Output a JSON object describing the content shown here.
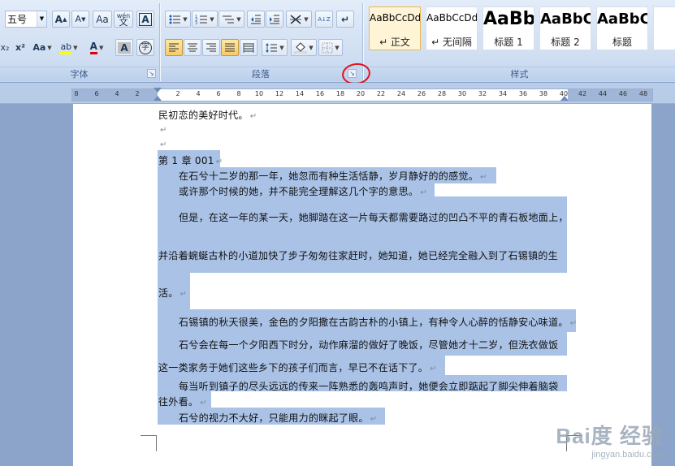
{
  "ribbon": {
    "font_group": {
      "label": "字体",
      "font_size": "五号",
      "grow_font": "A",
      "shrink_font": "A",
      "subscript": "x₂",
      "superscript": "x²",
      "change_case": "Aa",
      "phonetic": "wén",
      "char_border": "A",
      "highlight": "ab",
      "font_color": "A",
      "char_shading": "A",
      "enclose_char": "字"
    },
    "paragraph_group": {
      "label": "段落",
      "sort": "A↓Z",
      "show_marks": "↵"
    },
    "styles_group": {
      "label": "样式",
      "tiles": [
        {
          "sample": "AaBbCcDd",
          "name": "↵ 正文"
        },
        {
          "sample": "AaBbCcDd",
          "name": "↵ 无间隔"
        },
        {
          "sample": "AaBb",
          "name": "标题 1"
        },
        {
          "sample": "AaBbC",
          "name": "标题 2"
        },
        {
          "sample": "AaBbC",
          "name": "标题"
        }
      ]
    }
  },
  "ruler": {
    "left_ticks": [
      "8",
      "6",
      "4",
      "2"
    ],
    "ticks": [
      "2",
      "4",
      "6",
      "8",
      "10",
      "12",
      "14",
      "16",
      "18",
      "20",
      "22",
      "24",
      "26",
      "28",
      "30",
      "32",
      "34",
      "36",
      "38",
      "40"
    ],
    "right_ticks": [
      "42",
      "44",
      "46",
      "48"
    ]
  },
  "document": {
    "lines": [
      "民初恋的美好时代。",
      "",
      "",
      "第 1 章 001",
      "在石兮十二岁的那一年，她忽而有种生活恬静，岁月静好的的感觉。",
      "或许那个时候的她，并不能完全理解这几个字的意思。",
      "但是，在这一年的某一天，她脚踏在这一片每天都需要路过的凹凸不平的青石板地面上，",
      "并沿着蜿蜒古朴的小道加快了步子匆匆往家赶时，她知道，她已经完全融入到了石锡镇的生",
      "活。",
      "石锡镇的秋天很美，金色的夕阳撒在古韵古朴的小镇上，有种令人心醉的恬静安心味道。",
      "石兮会在每一个夕阳西下时分，动作麻溜的做好了晚饭，尽管她才十二岁，但洗衣做饭",
      "这一类家务于她们这些乡下的孩子们而言，早已不在话下了。",
      "每当听到镇子的尽头远远的传来一阵熟悉的轰鸣声时，她便会立即踮起了脚尖伸着脑袋",
      "往外看。",
      "石兮的视力不大好，只能用力的眯起了眼。"
    ],
    "paragraph_mark": "↵"
  },
  "watermark": {
    "main": "Bai度 经验",
    "sub": "jingyan.baidu.com"
  }
}
